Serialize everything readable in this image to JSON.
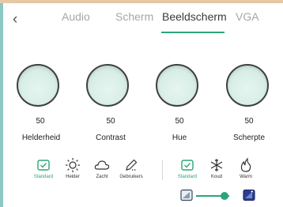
{
  "tabs": [
    {
      "label": "Audio"
    },
    {
      "label": "Scherm"
    },
    {
      "label": "Beeldscherm"
    },
    {
      "label": "VGA"
    }
  ],
  "active_tab": "Beeldscherm",
  "knobs": [
    {
      "value": "50",
      "label": "Helderheid"
    },
    {
      "value": "50",
      "label": "Contrast"
    },
    {
      "value": "50",
      "label": "Hue"
    },
    {
      "value": "50",
      "label": "Scherpte"
    }
  ],
  "picture_modes": [
    {
      "label": "Standard",
      "icon": "check-square-icon",
      "selected": true
    },
    {
      "label": "Helder",
      "icon": "sun-icon",
      "selected": false
    },
    {
      "label": "Zacht",
      "icon": "cloud-icon",
      "selected": false
    },
    {
      "label": "Gebruikers",
      "icon": "pencil-icon",
      "selected": false
    }
  ],
  "color_temps": [
    {
      "label": "Standard",
      "icon": "check-square-icon",
      "selected": true
    },
    {
      "label": "Koud",
      "icon": "snowflake-icon",
      "selected": false
    },
    {
      "label": "Warm",
      "icon": "flame-icon",
      "selected": false
    }
  ],
  "backlight_slider": {
    "value_fraction": 0.85
  },
  "colors": {
    "accent": "#2aa676",
    "knob_fill": "#d9eee8"
  }
}
